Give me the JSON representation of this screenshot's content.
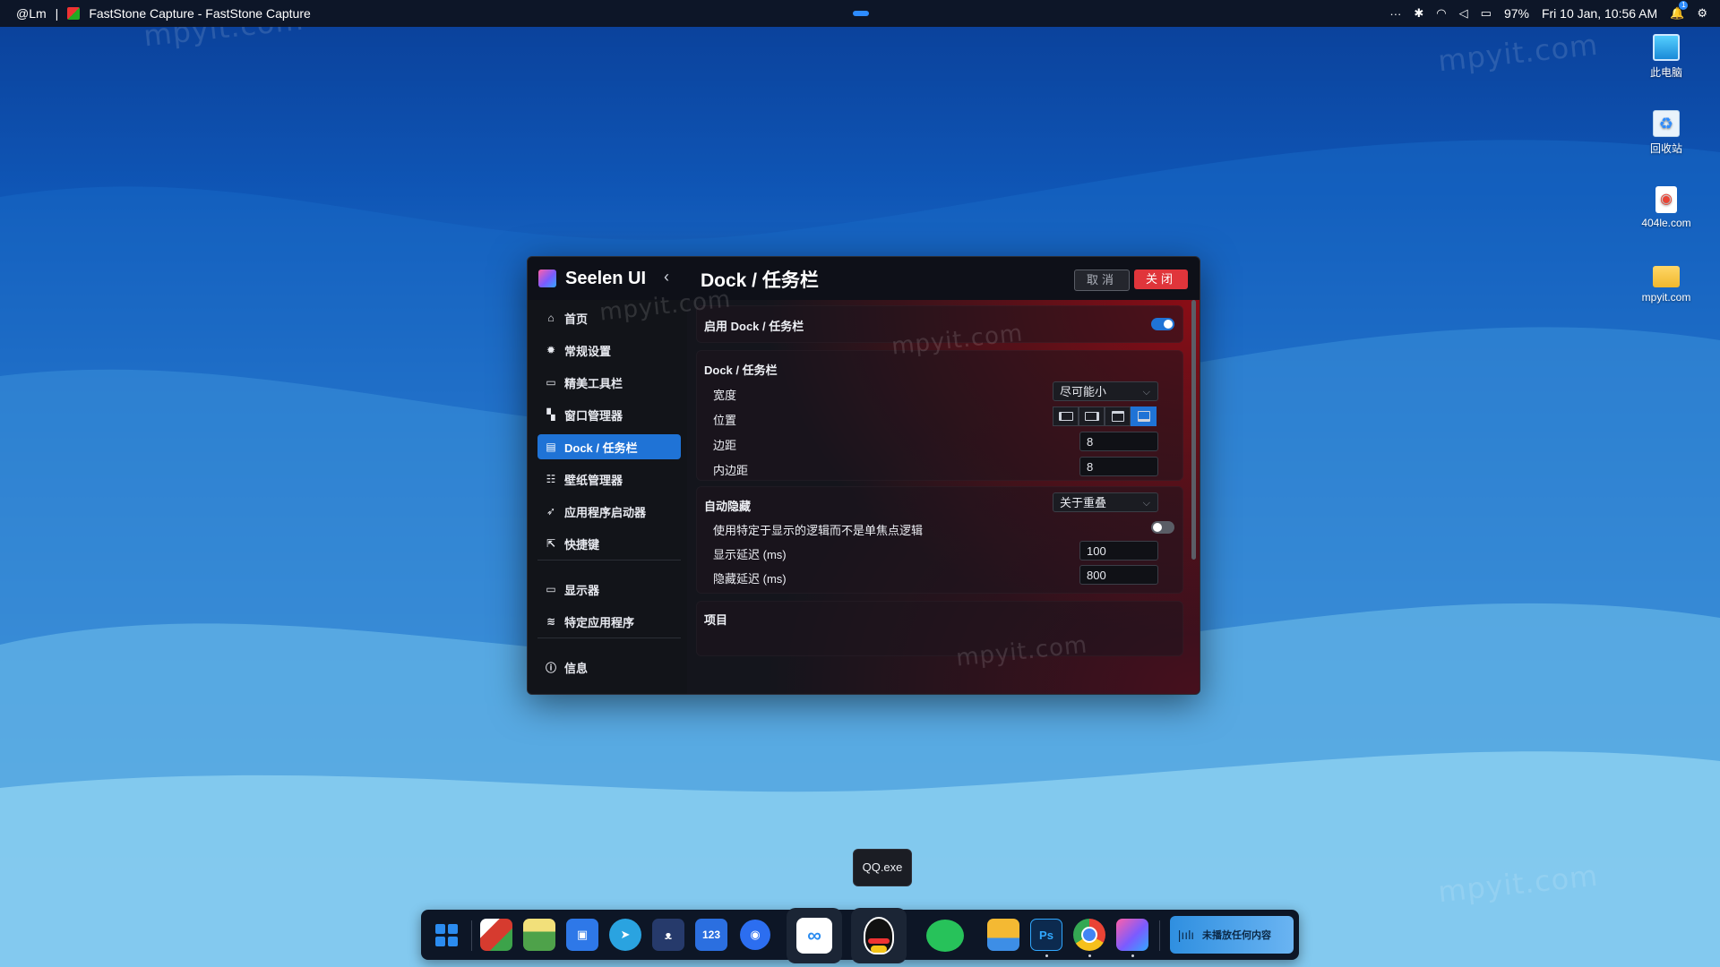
{
  "topbar": {
    "user": "@Lm",
    "separator": "|",
    "window_title": "FastStone Capture - FastStone Capture",
    "more": "···",
    "battery_pct": "97%",
    "datetime": "Fri 10 Jan, 10:56 AM",
    "notification_count": "1"
  },
  "watermark": "mpyit.com",
  "desktop_icons": [
    {
      "label": "此电脑",
      "icon": "computer-icon"
    },
    {
      "label": "回收站",
      "icon": "recycle-bin-icon"
    },
    {
      "label": "404le.com",
      "icon": "file-icon"
    },
    {
      "label": "mpyit.com",
      "icon": "folder-icon"
    }
  ],
  "window": {
    "app_name": "Seelen UI",
    "page_title": "Dock / 任务栏",
    "cancel_label": "取消",
    "close_label": "关闭"
  },
  "sidebar": {
    "items": [
      {
        "label": "首页",
        "icon": "home-icon",
        "glyph": "⌂"
      },
      {
        "label": "常规设置",
        "icon": "gear-icon",
        "glyph": "✹"
      },
      {
        "label": "精美工具栏",
        "icon": "toolbar-icon",
        "glyph": "▭"
      },
      {
        "label": "窗口管理器",
        "icon": "window-manager-icon",
        "glyph": "▚"
      },
      {
        "label": "Dock / 任务栏",
        "icon": "dock-icon",
        "glyph": "▤",
        "active": true
      },
      {
        "label": "壁纸管理器",
        "icon": "wallpaper-icon",
        "glyph": "☷"
      },
      {
        "label": "应用程序启动器",
        "icon": "rocket-icon",
        "glyph": "➶"
      },
      {
        "label": "快捷键",
        "icon": "shortcut-icon",
        "glyph": "⇱"
      },
      {
        "label": "显示器",
        "icon": "monitor-icon",
        "glyph": "▭"
      },
      {
        "label": "特定应用程序",
        "icon": "layers-icon",
        "glyph": "≋"
      },
      {
        "label": "信息",
        "icon": "info-icon",
        "glyph": "ⓘ"
      }
    ]
  },
  "main": {
    "enable": {
      "label": "启用 Dock / 任务栏",
      "on": true
    },
    "dock_section": {
      "title": "Dock / 任务栏",
      "width_label": "宽度",
      "width_value": "尽可能小",
      "position_label": "位置",
      "position_selected": "bottom",
      "margin_label": "边距",
      "margin_value": "8",
      "padding_label": "内边距",
      "padding_value": "8"
    },
    "autohide_section": {
      "title": "自动隐藏",
      "mode_value": "关于重叠",
      "logic_label": "使用特定于显示的逻辑而不是单焦点逻辑",
      "logic_on": false,
      "show_delay_label": "显示延迟 (ms)",
      "show_delay_value": "100",
      "hide_delay_label": "隐藏延迟 (ms)",
      "hide_delay_value": "800"
    },
    "items_section": {
      "title": "项目"
    }
  },
  "tooltip": "QQ.exe",
  "dock": {
    "media_text": "未播放任何内容",
    "items": [
      {
        "name": "start-menu-icon",
        "color": "#2b8cf0"
      },
      {
        "name": "faststone-icon",
        "color": "#d63b2f"
      },
      {
        "name": "image-viewer-icon",
        "color": "#4ea24a"
      },
      {
        "name": "screenshot-tool-icon",
        "color": "#2e78e8"
      },
      {
        "name": "telegram-icon",
        "color": "#2aa3e0"
      },
      {
        "name": "cat-app-icon",
        "color": "#263a6b"
      },
      {
        "name": "123-cloud-icon",
        "color": "#2b6fe0"
      },
      {
        "name": "chat-bubble-icon",
        "color": "#2c6ef0"
      },
      {
        "name": "baidu-netdisk-icon",
        "color": "#ffffff"
      },
      {
        "name": "qq-icon",
        "color": "#111111"
      },
      {
        "name": "wechat-icon",
        "color": "#27c25a"
      },
      {
        "name": "file-explorer-icon",
        "color": "#f4b933"
      },
      {
        "name": "photoshop-icon",
        "color": "#0c2a4f"
      },
      {
        "name": "chrome-icon",
        "color": "#e94335"
      },
      {
        "name": "seelen-ui-icon",
        "color": "#7b5bff"
      }
    ],
    "photoshop_label": "Ps",
    "app_123_label": "123"
  }
}
